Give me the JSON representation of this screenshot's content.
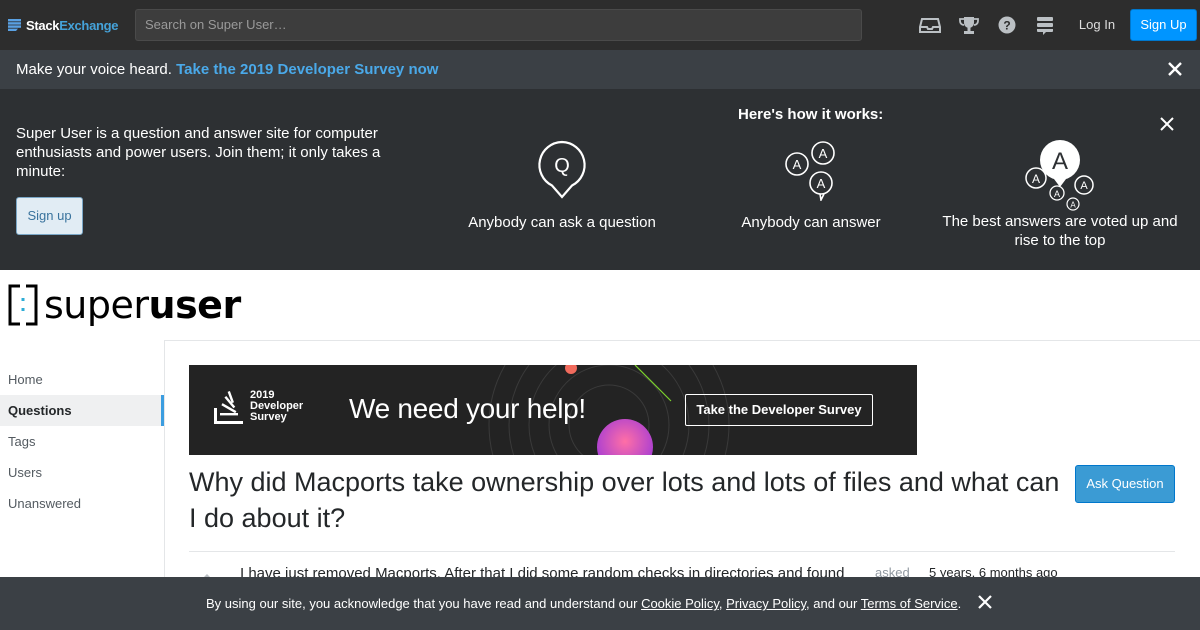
{
  "topbar": {
    "brand_stack": "Stack",
    "brand_exchange": "Exchange",
    "search_placeholder": "Search on Super User…",
    "icons": [
      "inbox-icon",
      "achievements-icon",
      "help-icon",
      "site-switcher-icon"
    ],
    "login_label": "Log In",
    "signup_label": "Sign Up"
  },
  "survey_strip": {
    "prefix": "Make your voice heard.",
    "link": "Take the 2019 Developer Survey now"
  },
  "hero": {
    "intro": "Super User is a question and answer site for computer enthusiasts and power users. Join them; it only takes a minute:",
    "signup_label": "Sign up",
    "how_title": "Here's how it works:",
    "steps": [
      {
        "icon": "question-bubble-icon",
        "label": "Anybody can ask a question"
      },
      {
        "icon": "answers-bubbles-icon",
        "label": "Anybody can answer"
      },
      {
        "icon": "voted-answer-icon",
        "label": "The best answers are voted up and rise to the top"
      }
    ]
  },
  "site_logo": {
    "word_light": "super",
    "word_bold": "user"
  },
  "leftnav": {
    "items": [
      {
        "label": "Home",
        "active": false
      },
      {
        "label": "Questions",
        "active": true
      },
      {
        "label": "Tags",
        "active": false
      },
      {
        "label": "Users",
        "active": false
      },
      {
        "label": "Unanswered",
        "active": false
      }
    ]
  },
  "ad_banner": {
    "year": "2019",
    "line1": "Developer",
    "line2": "Survey",
    "headline": "We need your help!",
    "cta": "Take the Developer Survey"
  },
  "question": {
    "title": "Why did Macports take ownership over lots and lots of files and what can I do about it?",
    "ask_button": "Ask Question",
    "body_start": "I have just removed Macports. After that I did some random checks in directories and found",
    "asked_label": "asked",
    "asked_value": "5 years, 6 months ago"
  },
  "cookie_bar": {
    "text_before": "By using our site, you acknowledge that you have read and understand our ",
    "cookie_policy": "Cookie Policy",
    "sep1": ", ",
    "privacy_policy": "Privacy Policy",
    "text_mid": ", and our ",
    "terms": "Terms of Service",
    "text_end": "."
  },
  "colors": {
    "topbar_bg": "#2d2d2d",
    "hero_bg": "#2d3033",
    "strip_bg": "#3b4045",
    "link_blue": "#4aa9e9",
    "primary_button": "#0095ff"
  }
}
